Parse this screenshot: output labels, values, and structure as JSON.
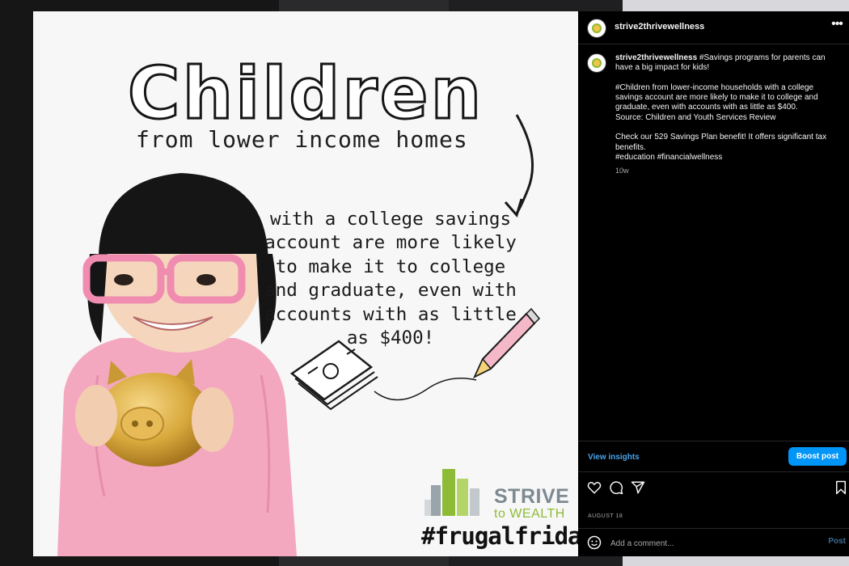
{
  "post": {
    "headline": "Children",
    "subhead": "from lower income homes",
    "body": "with a college savings\naccount are more likely\nto make it to college\nand graduate, even with\naccounts with as little\nas $400!",
    "logo": {
      "line1": "STRIVE",
      "line2": "to WEALTH"
    },
    "hashtag": "#frugalfriday"
  },
  "panel": {
    "username": "strive2thrivewellness",
    "caption": {
      "user": "strive2thrivewellness",
      "line1": " #Savings programs for parents can have a big impact for kids!",
      "line2": "#Children from lower-income households with a college savings account are more likely to make it to college and graduate, even with accounts with as little as $400.",
      "line3": "Source: Children and Youth Services Review",
      "line4": "Check our 529 Savings Plan benefit! It offers significant tax benefits.",
      "line5": "#education #financialwellness",
      "time": "10w"
    },
    "view_insights": "View insights",
    "boost_label": "Boost post",
    "date": "AUGUST 18",
    "comment_placeholder": "Add a comment...",
    "post_label": "Post"
  },
  "colors": {
    "accent": "#0095f6",
    "link": "#4aa3ea",
    "logo_grey": "#7d8a92",
    "logo_green": "#8dbb35",
    "shirt_pink": "#f4a8bf",
    "glasses_pink": "#f08cb0",
    "piggy_gold": "#d8a93c"
  },
  "icons": [
    "more-icon",
    "heart-icon",
    "comment-icon",
    "share-icon",
    "bookmark-icon",
    "emoji-icon",
    "arrow-doodle-icon",
    "money-stack-icon",
    "pencil-icon",
    "building-logo-icon"
  ]
}
